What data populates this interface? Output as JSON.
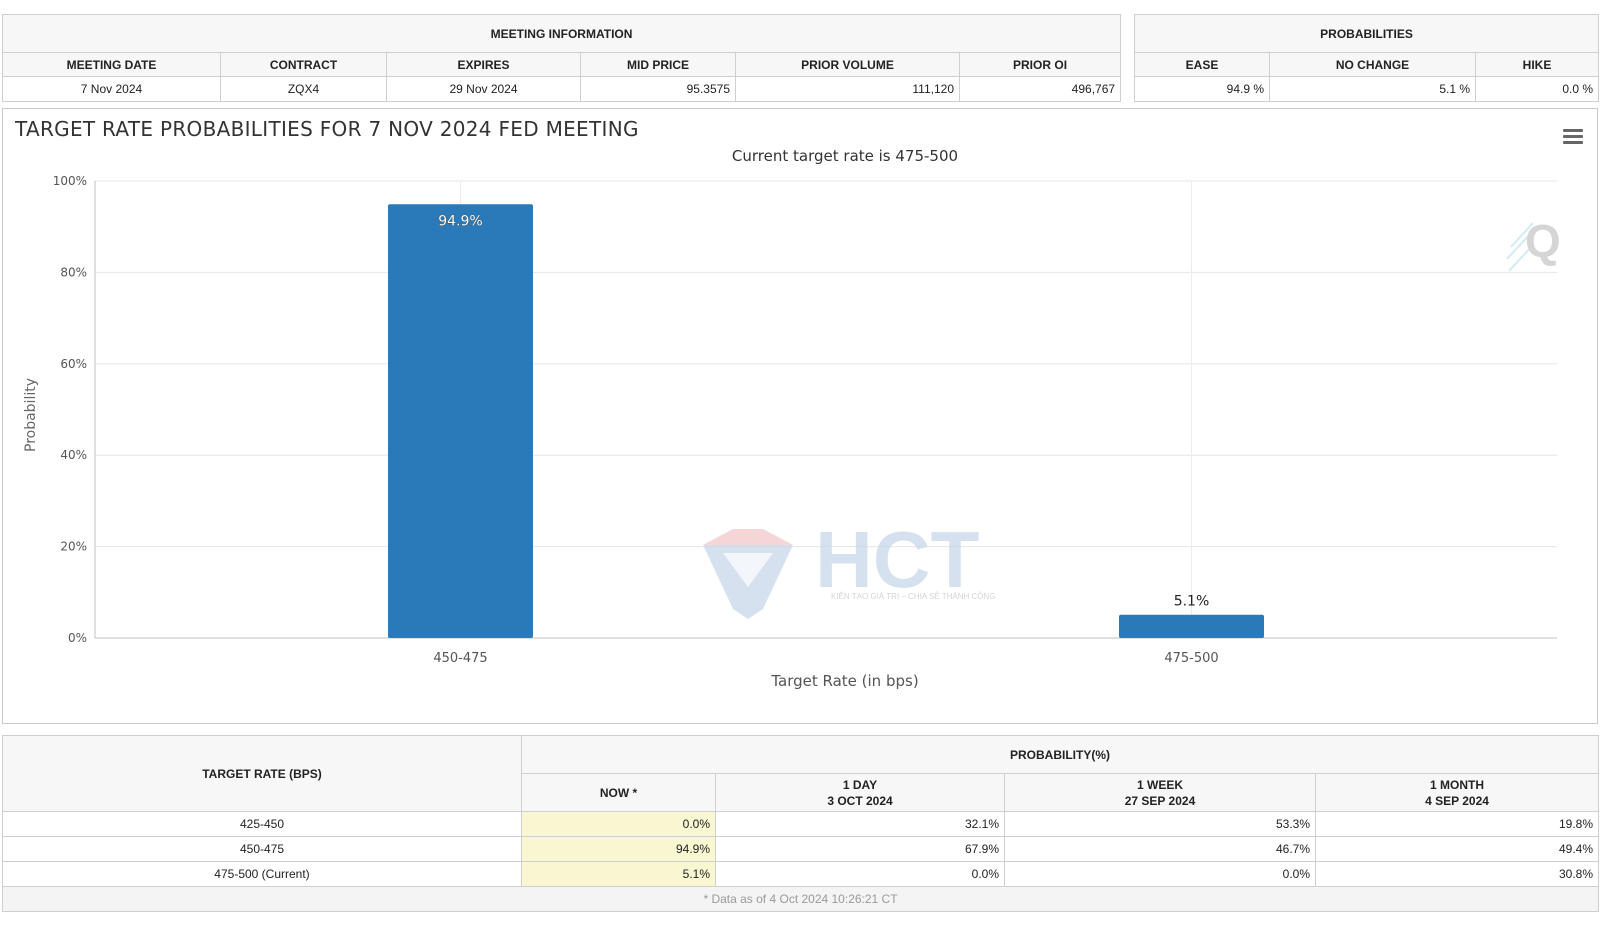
{
  "meeting_info": {
    "group_title": "MEETING INFORMATION",
    "headers": [
      "MEETING DATE",
      "CONTRACT",
      "EXPIRES",
      "MID PRICE",
      "PRIOR VOLUME",
      "PRIOR OI"
    ],
    "values": [
      "7 Nov 2024",
      "ZQX4",
      "29 Nov 2024",
      "95.3575",
      "111,120",
      "496,767"
    ]
  },
  "probabilities": {
    "group_title": "PROBABILITIES",
    "headers": [
      "EASE",
      "NO CHANGE",
      "HIKE"
    ],
    "values": [
      "94.9 %",
      "5.1 %",
      "0.0 %"
    ]
  },
  "chart_data": {
    "type": "bar",
    "title": "TARGET RATE PROBABILITIES FOR 7 NOV 2024 FED MEETING",
    "subtitle": "Current target rate is 475-500",
    "categories": [
      "450-475",
      "475-500"
    ],
    "values": [
      94.9,
      5.1
    ],
    "data_labels": [
      "94.9%",
      "5.1%"
    ],
    "xlabel": "Target Rate (in bps)",
    "ylabel": "Probability",
    "ylim": [
      0,
      100
    ],
    "yticks": [
      "0%",
      "20%",
      "40%",
      "60%",
      "80%",
      "100%"
    ],
    "grid": true,
    "bar_color": "#2a7ab9"
  },
  "watermark": {
    "brand": "HCT",
    "tagline": "KIẾN TẠO GIÁ TRỊ – CHIA SẺ THÀNH CÔNG"
  },
  "history": {
    "target_rate_header": "TARGET RATE (BPS)",
    "probability_header": "PROBABILITY(%)",
    "columns": [
      {
        "line1": "NOW *",
        "line2": ""
      },
      {
        "line1": "1 DAY",
        "line2": "3 OCT 2024"
      },
      {
        "line1": "1 WEEK",
        "line2": "27 SEP 2024"
      },
      {
        "line1": "1 MONTH",
        "line2": "4 SEP 2024"
      }
    ],
    "rows": [
      {
        "rate": "425-450",
        "values": [
          "0.0%",
          "32.1%",
          "53.3%",
          "19.8%"
        ]
      },
      {
        "rate": "450-475",
        "values": [
          "94.9%",
          "67.9%",
          "46.7%",
          "49.4%"
        ]
      },
      {
        "rate": "475-500 (Current)",
        "values": [
          "5.1%",
          "0.0%",
          "0.0%",
          "30.8%"
        ]
      }
    ],
    "footnote": "* Data as of 4 Oct 2024 10:26:21 CT"
  }
}
